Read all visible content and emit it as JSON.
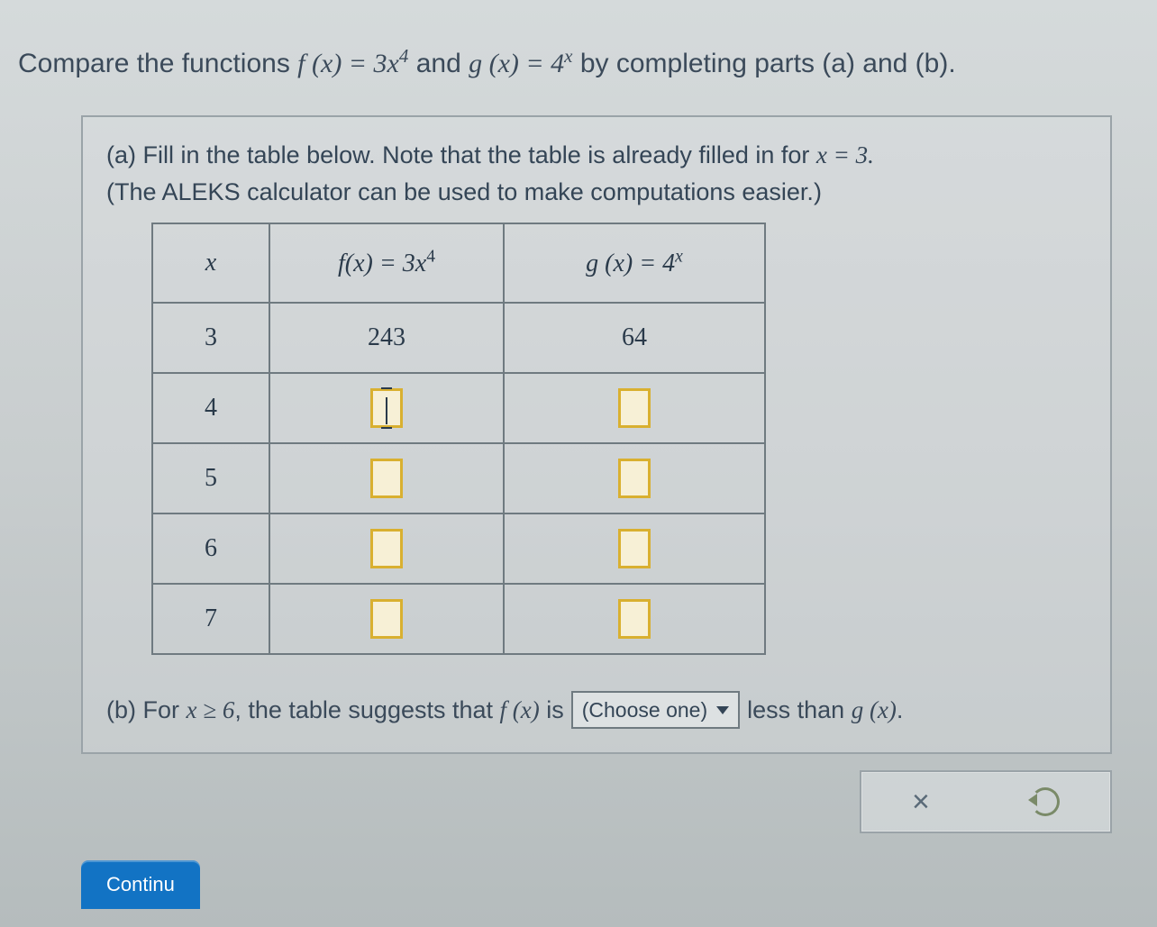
{
  "prompt": {
    "pre": "Compare the functions ",
    "f_lhs": "f (x) = 3x",
    "f_exp": "4",
    "mid": " and ",
    "g_lhs": "g (x) = 4",
    "g_exp": "x",
    "post": " by completing parts (a) and (b)."
  },
  "part_a": {
    "line1_pre": "(a) Fill in the table below. Note that the table is already filled in for ",
    "line1_expr": "x = 3.",
    "line2": "(The ALEKS calculator can be used to make computations easier.)"
  },
  "table": {
    "header": {
      "x": "x",
      "f_lhs": "f(x) = 3x",
      "f_exp": "4",
      "g_lhs": "g (x) = 4",
      "g_exp": "x"
    },
    "rows": [
      {
        "x": "3",
        "f": "243",
        "g": "64",
        "editable": false
      },
      {
        "x": "4",
        "f": "",
        "g": "",
        "editable": true,
        "focus": true
      },
      {
        "x": "5",
        "f": "",
        "g": "",
        "editable": true
      },
      {
        "x": "6",
        "f": "",
        "g": "",
        "editable": true
      },
      {
        "x": "7",
        "f": "",
        "g": "",
        "editable": true
      }
    ]
  },
  "part_b": {
    "pre": "(b) For ",
    "cond": "x ≥ 6",
    "mid1": ", the table suggests that ",
    "fx": "f (x)",
    "mid2": " is",
    "dropdown": "(Choose one)",
    "post1": "less than ",
    "gx": "g (x)",
    "post2": "."
  },
  "toolbar": {
    "clear": "×",
    "undo": "undo"
  },
  "continue_label": "Continu"
}
